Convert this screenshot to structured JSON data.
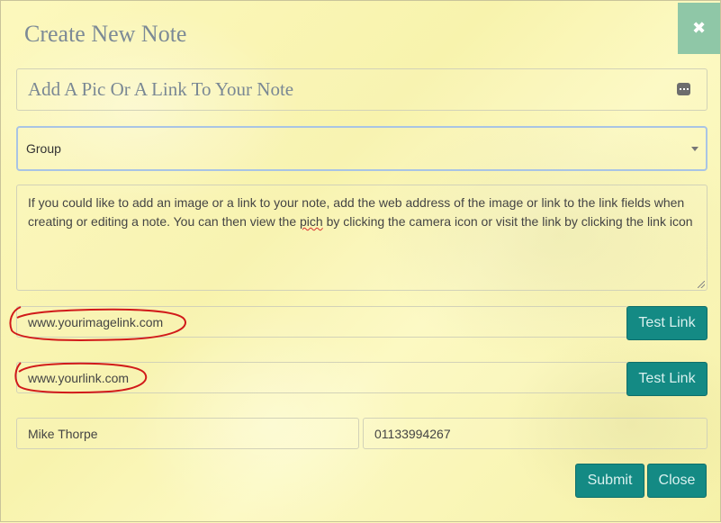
{
  "dialog": {
    "title": "Create New Note",
    "close_glyph": "✖"
  },
  "form": {
    "title_value": "Add A Pic Or A Link To Your Note",
    "group_value": "Group",
    "body_before": "If you could like to add an image or a link to your note, add the web address of the image or link to the link fields when creating or editing a note. You can then view the ",
    "body_misspelled": "pich",
    "body_after": " by clicking the camera icon or visit the link by clicking the link icon",
    "image_link_value": "www.yourimagelink.com",
    "web_link_value": "www.yourlink.com",
    "test_link_label": "Test Link",
    "name_value": "Mike Thorpe",
    "phone_value": "01133994267"
  },
  "footer": {
    "submit_label": "Submit",
    "close_label": "Close"
  },
  "colors": {
    "background": "#fbf7b6",
    "accent_button": "#148a84",
    "close_x": "#8fc7a7",
    "annotation_red": "#d11a1a"
  }
}
